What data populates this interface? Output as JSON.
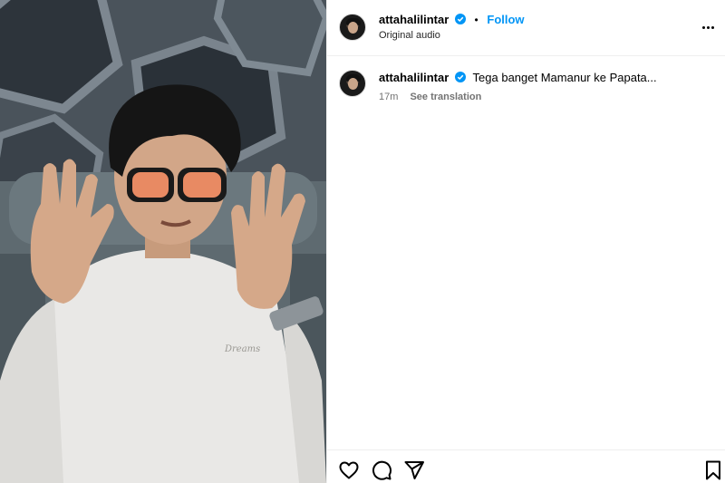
{
  "post": {
    "username": "attahalilintar",
    "follow_label": "Follow",
    "separator": "•",
    "audio_label": "Original audio",
    "caption": "Tega banget Mamanur ke Papata...",
    "time_ago": "17m",
    "translation_label": "See translation"
  },
  "icons": {
    "verified": "verified-badge-icon",
    "more": "more-options-icon",
    "like": "heart-icon",
    "comment": "comment-icon",
    "share": "send-icon",
    "save": "bookmark-icon"
  },
  "colors": {
    "follow": "#0095f6",
    "verified": "#0095f6",
    "meta_text": "#737373"
  }
}
